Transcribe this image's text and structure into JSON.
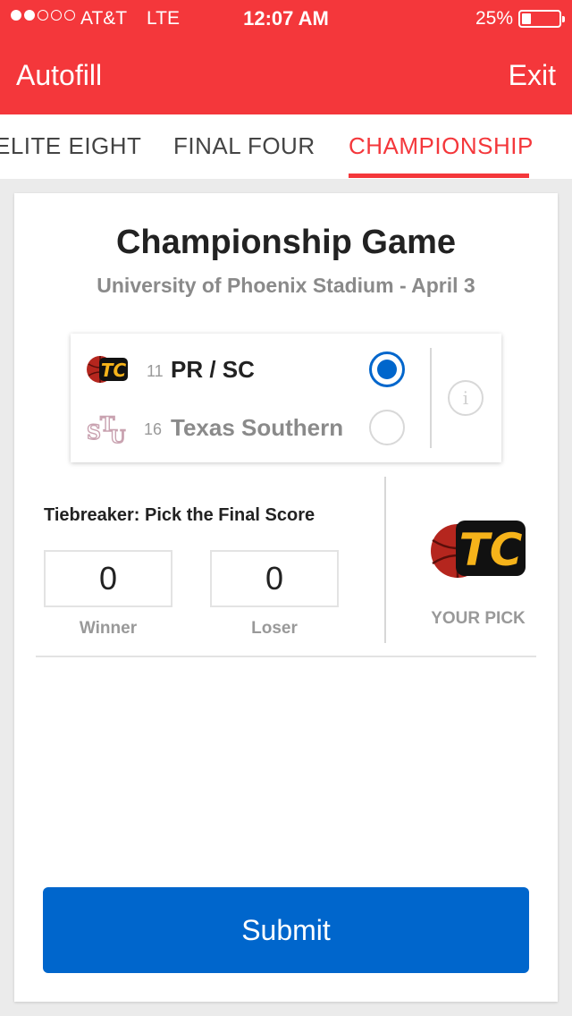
{
  "status_bar": {
    "carrier": "AT&T",
    "network": "LTE",
    "time": "12:07 AM",
    "battery": "25%",
    "battery_level": 0.25,
    "signal_bars_on": 2,
    "signal_bars_total": 5
  },
  "nav": {
    "left": "Autofill",
    "right": "Exit"
  },
  "tabs": [
    {
      "label": "ELITE EIGHT",
      "active": false
    },
    {
      "label": "FINAL FOUR",
      "active": false
    },
    {
      "label": "CHAMPIONSHIP",
      "active": true
    }
  ],
  "game": {
    "title": "Championship Game",
    "subtitle": "University of Phoenix Stadium - April 3"
  },
  "matchup": {
    "teams": [
      {
        "seed": "11",
        "name": "PR / SC",
        "logo": "tc-basketball-logo",
        "selected": true
      },
      {
        "seed": "16",
        "name": "Texas Southern",
        "logo": "tsu-logo",
        "selected": false
      }
    ],
    "info_icon": "info-icon"
  },
  "tiebreaker": {
    "label": "Tiebreaker: Pick the Final Score",
    "winner_value": "0",
    "winner_label": "Winner",
    "loser_value": "0",
    "loser_label": "Loser"
  },
  "pick": {
    "label": "YOUR PICK",
    "logo": "tc-basketball-logo"
  },
  "submit_label": "Submit",
  "colors": {
    "brand_red": "#f4373b",
    "accent_blue": "#0066cc",
    "muted_gray": "#8a8a8a"
  }
}
